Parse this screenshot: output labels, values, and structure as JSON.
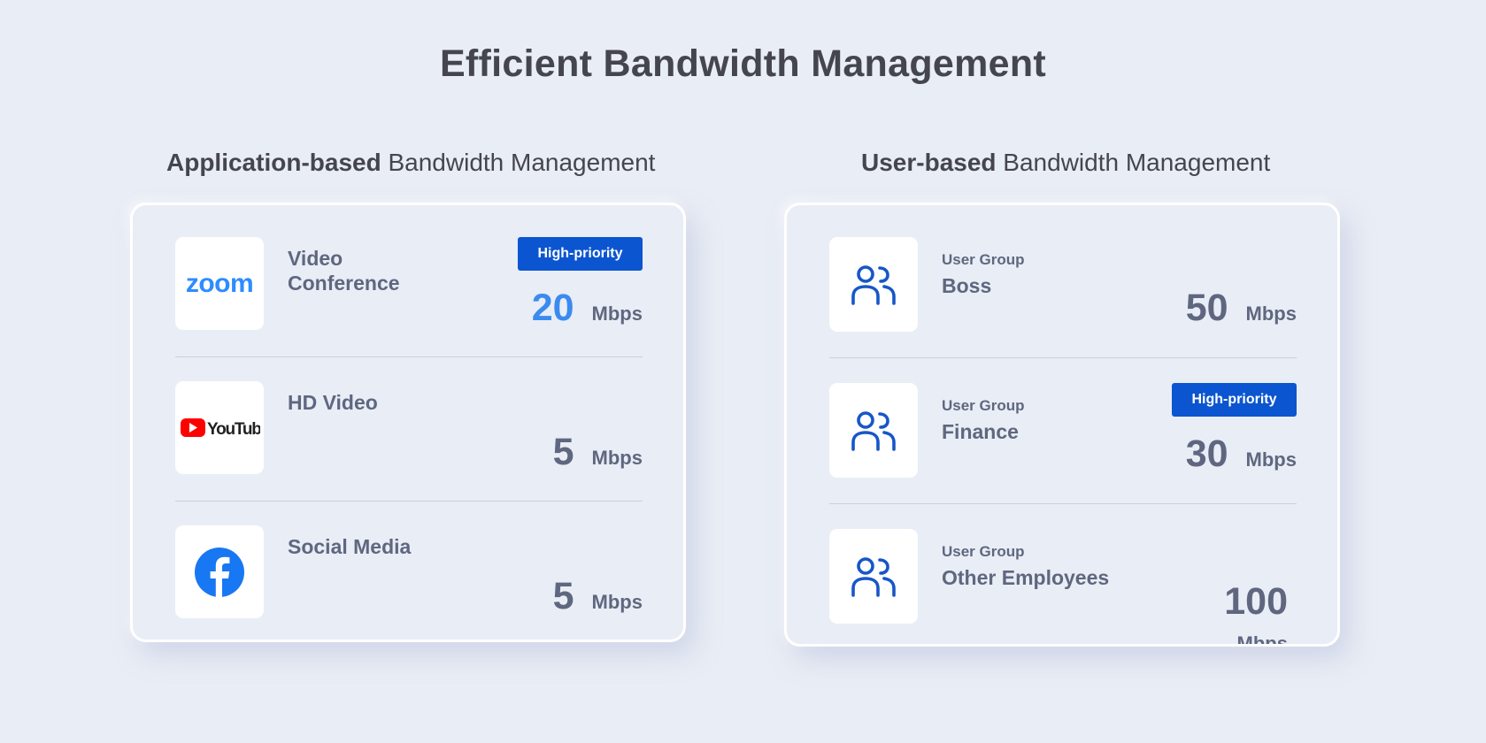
{
  "page": {
    "title": "Efficient Bandwidth Management"
  },
  "app_section": {
    "heading_bold": "Application-based",
    "heading_rest": " Bandwidth Management",
    "items": [
      {
        "icon": "zoom-logo",
        "label": "Video Conference",
        "badge": "High-priority",
        "value": "20",
        "unit": "Mbps",
        "value_color": "#3a8bf0"
      },
      {
        "icon": "youtube-logo",
        "label": "HD Video",
        "value": "5",
        "unit": "Mbps"
      },
      {
        "icon": "facebook-logo",
        "label": "Social Media",
        "value": "5",
        "unit": "Mbps"
      }
    ],
    "logos": {
      "zoom": "zoom",
      "youtube": "YouTube"
    }
  },
  "user_section": {
    "heading_bold": "User-based",
    "heading_rest": " Bandwidth Management",
    "items": [
      {
        "icon": "user-group-icon",
        "caption": "User Group",
        "name": "Boss",
        "value": "50",
        "unit": "Mbps"
      },
      {
        "icon": "user-group-icon",
        "caption": "User Group",
        "name": "Finance",
        "badge": "High-priority",
        "value": "30",
        "unit": "Mbps"
      },
      {
        "icon": "user-group-icon",
        "caption": "User Group",
        "name": "Other Employees",
        "value": "100",
        "unit": "Mbps"
      }
    ]
  },
  "colors": {
    "background": "#e9edf5",
    "badge": "#0b55d0",
    "accent_value": "#3a8bf0",
    "icon_blue": "#1756c8",
    "text_muted": "#5f6780"
  }
}
